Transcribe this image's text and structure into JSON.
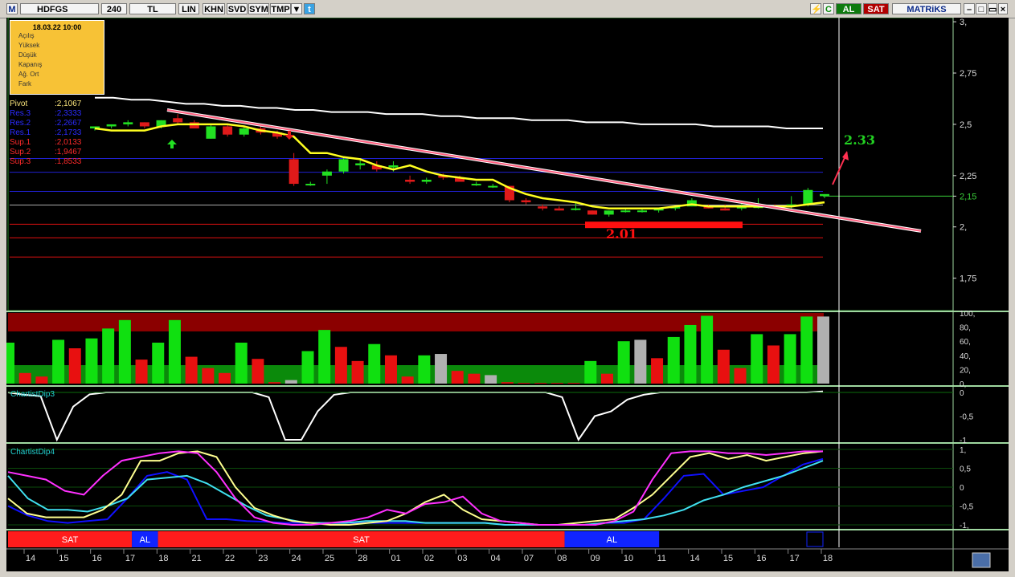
{
  "toolbar": {
    "logo": "M",
    "symbol": "HDFGS",
    "period": "240",
    "currency": "TL",
    "buttons": [
      "LIN",
      "KHN",
      "SVD",
      "SYM",
      "TMP"
    ],
    "right_c": "C",
    "al": "AL",
    "sat": "SAT",
    "brand": "MATRiKS"
  },
  "info_box": {
    "date": "18.03.22 10:00",
    "rows": [
      "Açılış",
      "Yüksek",
      "Düşük",
      "Kapanış",
      "Ağ. Ort",
      "Fark"
    ]
  },
  "pivots": [
    {
      "label": "Pivot",
      "value": ":2,1067",
      "color": "#f7e27a"
    },
    {
      "label": "Res.3",
      "value": ":2,3333",
      "color": "#2b2bff"
    },
    {
      "label": "Res.2",
      "value": ":2,2667",
      "color": "#2b2bff"
    },
    {
      "label": "Res.1",
      "value": ":2,1733",
      "color": "#2b2bff"
    },
    {
      "label": "Sup.1",
      "value": ":2,0133",
      "color": "#ff2a2a"
    },
    {
      "label": "Sup.2",
      "value": ":1,9467",
      "color": "#ff2a2a"
    },
    {
      "label": "Sup.3",
      "value": ":1,8533",
      "color": "#ff2a2a"
    }
  ],
  "chart_data": {
    "type": "candlestick",
    "symbol": "HDFGS",
    "y_axis_labels": [
      "3,",
      "2,75",
      "2,5",
      "2,25",
      "2,15",
      "2,",
      "1,75"
    ],
    "ylim": [
      1.6,
      3.02
    ],
    "current_price_label": "2,15",
    "annotations": [
      "2.33",
      "2.01"
    ],
    "x_labels": [
      "14",
      "15",
      "16",
      "17",
      "18",
      "21",
      "22",
      "23",
      "24",
      "25",
      "28",
      "01",
      "02",
      "03",
      "04",
      "07",
      "08",
      "09",
      "10",
      "11",
      "14",
      "15",
      "16",
      "17",
      "18"
    ],
    "candles": [
      {
        "o": 2.48,
        "h": 2.49,
        "l": 2.47,
        "c": 2.49
      },
      {
        "o": 2.49,
        "h": 2.5,
        "l": 2.48,
        "c": 2.5
      },
      {
        "o": 2.5,
        "h": 2.52,
        "l": 2.49,
        "c": 2.51
      },
      {
        "o": 2.51,
        "h": 2.51,
        "l": 2.48,
        "c": 2.49
      },
      {
        "o": 2.49,
        "h": 2.52,
        "l": 2.48,
        "c": 2.52
      },
      {
        "o": 2.53,
        "h": 2.55,
        "l": 2.5,
        "c": 2.51
      },
      {
        "o": 2.51,
        "h": 2.52,
        "l": 2.48,
        "c": 2.48
      },
      {
        "o": 2.43,
        "h": 2.5,
        "l": 2.43,
        "c": 2.49
      },
      {
        "o": 2.49,
        "h": 2.5,
        "l": 2.44,
        "c": 2.45
      },
      {
        "o": 2.45,
        "h": 2.49,
        "l": 2.44,
        "c": 2.48
      },
      {
        "o": 2.48,
        "h": 2.49,
        "l": 2.45,
        "c": 2.46
      },
      {
        "o": 2.46,
        "h": 2.47,
        "l": 2.43,
        "c": 2.44
      },
      {
        "o": 2.33,
        "h": 2.36,
        "l": 2.2,
        "c": 2.21
      },
      {
        "o": 2.21,
        "h": 2.22,
        "l": 2.2,
        "c": 2.21
      },
      {
        "o": 2.25,
        "h": 2.28,
        "l": 2.21,
        "c": 2.27
      },
      {
        "o": 2.27,
        "h": 2.34,
        "l": 2.26,
        "c": 2.33
      },
      {
        "o": 2.3,
        "h": 2.33,
        "l": 2.28,
        "c": 2.31
      },
      {
        "o": 2.3,
        "h": 2.32,
        "l": 2.27,
        "c": 2.28
      },
      {
        "o": 2.29,
        "h": 2.32,
        "l": 2.27,
        "c": 2.3
      },
      {
        "o": 2.23,
        "h": 2.25,
        "l": 2.21,
        "c": 2.22
      },
      {
        "o": 2.22,
        "h": 2.24,
        "l": 2.21,
        "c": 2.23
      },
      {
        "o": 2.25,
        "h": 2.26,
        "l": 2.23,
        "c": 2.24
      },
      {
        "o": 2.24,
        "h": 2.25,
        "l": 2.22,
        "c": 2.22
      },
      {
        "o": 2.21,
        "h": 2.22,
        "l": 2.2,
        "c": 2.21
      },
      {
        "o": 2.2,
        "h": 2.21,
        "l": 2.19,
        "c": 2.2
      },
      {
        "o": 2.2,
        "h": 2.2,
        "l": 2.12,
        "c": 2.13
      },
      {
        "o": 2.13,
        "h": 2.14,
        "l": 2.11,
        "c": 2.12
      },
      {
        "o": 2.1,
        "h": 2.11,
        "l": 2.08,
        "c": 2.09
      },
      {
        "o": 2.09,
        "h": 2.1,
        "l": 2.08,
        "c": 2.08
      },
      {
        "o": 2.09,
        "h": 2.12,
        "l": 2.08,
        "c": 2.09
      },
      {
        "o": 2.08,
        "h": 2.08,
        "l": 2.06,
        "c": 2.06
      },
      {
        "o": 2.06,
        "h": 2.08,
        "l": 2.05,
        "c": 2.08
      },
      {
        "o": 2.08,
        "h": 2.09,
        "l": 2.07,
        "c": 2.08
      },
      {
        "o": 2.08,
        "h": 2.09,
        "l": 2.07,
        "c": 2.08
      },
      {
        "o": 2.08,
        "h": 2.09,
        "l": 2.07,
        "c": 2.09
      },
      {
        "o": 2.09,
        "h": 2.1,
        "l": 2.08,
        "c": 2.1
      },
      {
        "o": 2.1,
        "h": 2.14,
        "l": 2.1,
        "c": 2.13
      },
      {
        "o": 2.1,
        "h": 2.11,
        "l": 2.09,
        "c": 2.09
      },
      {
        "o": 2.09,
        "h": 2.11,
        "l": 2.08,
        "c": 2.08
      },
      {
        "o": 2.09,
        "h": 2.12,
        "l": 2.08,
        "c": 2.1
      },
      {
        "o": 2.1,
        "h": 2.14,
        "l": 2.09,
        "c": 2.1
      },
      {
        "o": 2.1,
        "h": 2.11,
        "l": 2.09,
        "c": 2.09
      },
      {
        "o": 2.1,
        "h": 2.15,
        "l": 2.09,
        "c": 2.11
      },
      {
        "o": 2.11,
        "h": 2.19,
        "l": 2.1,
        "c": 2.18
      },
      {
        "o": 2.15,
        "h": 2.16,
        "l": 2.14,
        "c": 2.16
      }
    ],
    "yellow_line": [
      2.48,
      2.47,
      2.47,
      2.47,
      2.49,
      2.5,
      2.5,
      2.5,
      2.5,
      2.49,
      2.47,
      2.46,
      2.44,
      2.36,
      2.36,
      2.34,
      2.33,
      2.3,
      2.28,
      2.3,
      2.27,
      2.25,
      2.24,
      2.23,
      2.23,
      2.19,
      2.16,
      2.14,
      2.13,
      2.12,
      2.1,
      2.09,
      2.09,
      2.09,
      2.09,
      2.1,
      2.11,
      2.1,
      2.1,
      2.1,
      2.1,
      2.1,
      2.1,
      2.11,
      2.12
    ],
    "white_line": [
      2.63,
      2.63,
      2.62,
      2.62,
      2.61,
      2.6,
      2.6,
      2.59,
      2.59,
      2.58,
      2.58,
      2.57,
      2.57,
      2.56,
      2.56,
      2.56,
      2.55,
      2.55,
      2.55,
      2.54,
      2.54,
      2.53,
      2.53,
      2.53,
      2.52,
      2.52,
      2.52,
      2.51,
      2.51,
      2.51,
      2.5,
      2.5,
      2.5,
      2.5,
      2.49,
      2.49,
      2.49,
      2.49,
      2.48,
      2.48,
      2.48
    ],
    "pivot_levels": [
      2.1067,
      2.3333,
      2.2667,
      2.1733,
      2.0133,
      1.9467,
      1.8533
    ],
    "indicator_rsi": {
      "ylabels": [
        "100,",
        "80,",
        "60,",
        "40,",
        "20,",
        "0,"
      ],
      "values": [
        58,
        15,
        10,
        62,
        50,
        64,
        78,
        90,
        34,
        58,
        90,
        38,
        22,
        15,
        58,
        35,
        2,
        5,
        46,
        76,
        52,
        32,
        56,
        40,
        10,
        40,
        42,
        18,
        14,
        12,
        2,
        1,
        1,
        1,
        1,
        32,
        14,
        60,
        62,
        36,
        66,
        83,
        96,
        48,
        22,
        70,
        54,
        70,
        95,
        95
      ],
      "colors": [
        "g",
        "r",
        "r",
        "g",
        "r",
        "g",
        "g",
        "g",
        "r",
        "g",
        "g",
        "r",
        "r",
        "r",
        "g",
        "r",
        "r",
        "w",
        "g",
        "g",
        "r",
        "r",
        "g",
        "r",
        "r",
        "g",
        "w",
        "r",
        "r",
        "w",
        "r",
        "r",
        "r",
        "r",
        "r",
        "g",
        "r",
        "g",
        "w",
        "r",
        "g",
        "g",
        "g",
        "r",
        "r",
        "g",
        "r",
        "g",
        "g",
        "w"
      ]
    },
    "chartistdip3": {
      "name": "ChartistDip3",
      "ylabels": [
        "0",
        "-0,5",
        "-1"
      ],
      "values": [
        0,
        -0.05,
        -0.08,
        -1,
        -0.3,
        -0.04,
        0,
        0,
        0,
        0,
        0,
        0,
        0,
        0,
        0,
        0,
        -0.1,
        -1,
        -1,
        -0.4,
        -0.05,
        0,
        0,
        0,
        0,
        0,
        0,
        0,
        0,
        0,
        0,
        0,
        0,
        0,
        -0.1,
        -1,
        -0.5,
        -0.4,
        -0.15,
        -0.05,
        0,
        0,
        0,
        0,
        0,
        0,
        0,
        0,
        0,
        0,
        0.02
      ]
    },
    "chartistdip4": {
      "name": "ChartistDip4",
      "ylabels": [
        "1,",
        "0,5",
        "0",
        "-0,5",
        "-1,"
      ],
      "yellow": [
        -0.3,
        -0.7,
        -0.8,
        -0.8,
        -0.8,
        -0.6,
        -0.2,
        0.7,
        0.7,
        0.9,
        0.95,
        0.8,
        0,
        -0.55,
        -0.75,
        -0.9,
        -0.95,
        -1,
        -1,
        -0.95,
        -0.9,
        -0.7,
        -0.4,
        -0.2,
        -0.6,
        -0.85,
        -0.9,
        -0.95,
        -1,
        -1,
        -0.95,
        -0.9,
        -0.85,
        -0.55,
        -0.2,
        0.3,
        0.8,
        0.9,
        0.75,
        0.85,
        0.7,
        0.8,
        0.9,
        0.95
      ],
      "magenta": [
        0.4,
        0.3,
        0.2,
        -0.1,
        -0.2,
        0.3,
        0.7,
        0.8,
        0.9,
        0.95,
        0.9,
        0.4,
        -0.3,
        -0.8,
        -0.95,
        -1,
        -1,
        -0.95,
        -0.9,
        -0.8,
        -0.6,
        -0.7,
        -0.45,
        -0.4,
        -0.25,
        -0.7,
        -0.9,
        -0.95,
        -1,
        -1,
        -1,
        -1,
        -0.9,
        -0.65,
        0.2,
        0.9,
        0.95,
        0.95,
        0.9,
        0.9,
        0.85,
        0.9,
        0.95,
        0.95
      ],
      "cyan": [
        0.3,
        -0.3,
        -0.6,
        -0.6,
        -0.65,
        -0.5,
        -0.3,
        0.2,
        0.25,
        0.3,
        0.1,
        -0.2,
        -0.5,
        -0.75,
        -0.85,
        -0.95,
        -0.95,
        -0.95,
        -0.9,
        -0.9,
        -0.9,
        -0.95,
        -0.95,
        -0.95,
        -0.95,
        -1,
        -1,
        -1,
        -1,
        -1,
        -0.95,
        -0.9,
        -0.85,
        -0.75,
        -0.6,
        -0.35,
        -0.2,
        0,
        0.15,
        0.3,
        0.5,
        0.7
      ],
      "blue": [
        -0.5,
        -0.75,
        -0.9,
        -0.95,
        -0.9,
        -0.85,
        -0.3,
        0.3,
        0.4,
        0.2,
        -0.85,
        -0.85,
        -0.9,
        -0.92,
        -0.95,
        -0.95,
        -0.95,
        -0.95,
        -0.95,
        -0.95,
        -0.95,
        -0.95,
        -0.95,
        -0.95,
        -0.95,
        -1,
        -1,
        -1,
        -1,
        -1,
        -0.95,
        -0.95,
        -0.85,
        -0.3,
        0.3,
        0.35,
        -0.2,
        -0.1,
        0,
        0.3,
        0.6,
        0.75
      ]
    },
    "signal_bar": [
      {
        "label": "SAT",
        "color": "#ff1c1c",
        "start": 0,
        "end": 0.152
      },
      {
        "label": "AL",
        "color": "#1024ff",
        "start": 0.152,
        "end": 0.184
      },
      {
        "label": "SAT",
        "color": "#ff1c1c",
        "start": 0.184,
        "end": 0.683
      },
      {
        "label": "AL",
        "color": "#1024ff",
        "start": 0.683,
        "end": 0.799
      }
    ]
  }
}
